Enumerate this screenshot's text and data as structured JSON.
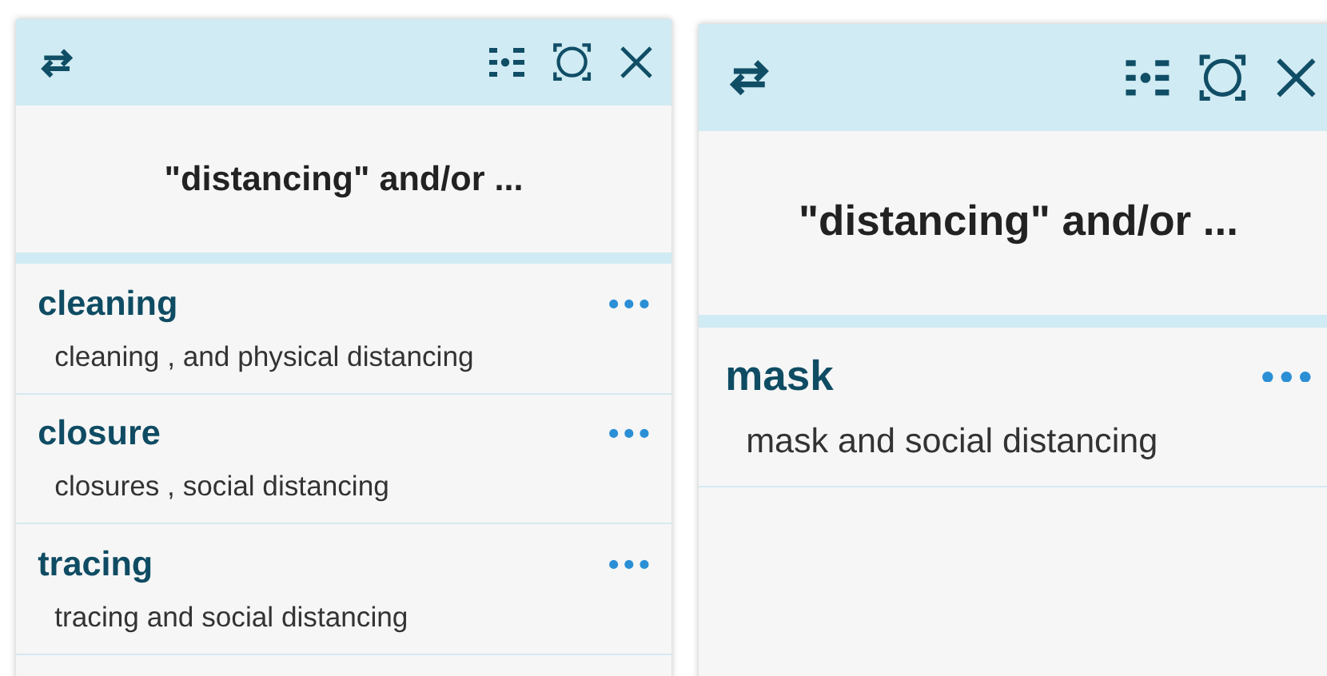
{
  "panels": [
    {
      "title": "\"distancing\" and/or ...",
      "items": [
        {
          "term": "cleaning",
          "description": "cleaning , and physical distancing"
        },
        {
          "term": "closure",
          "description": "closures , social distancing"
        },
        {
          "term": "tracing",
          "description": "tracing and social distancing"
        }
      ]
    },
    {
      "title": "\"distancing\" and/or ...",
      "items": [
        {
          "term": "mask",
          "description": "mask and social distancing"
        }
      ]
    }
  ]
}
